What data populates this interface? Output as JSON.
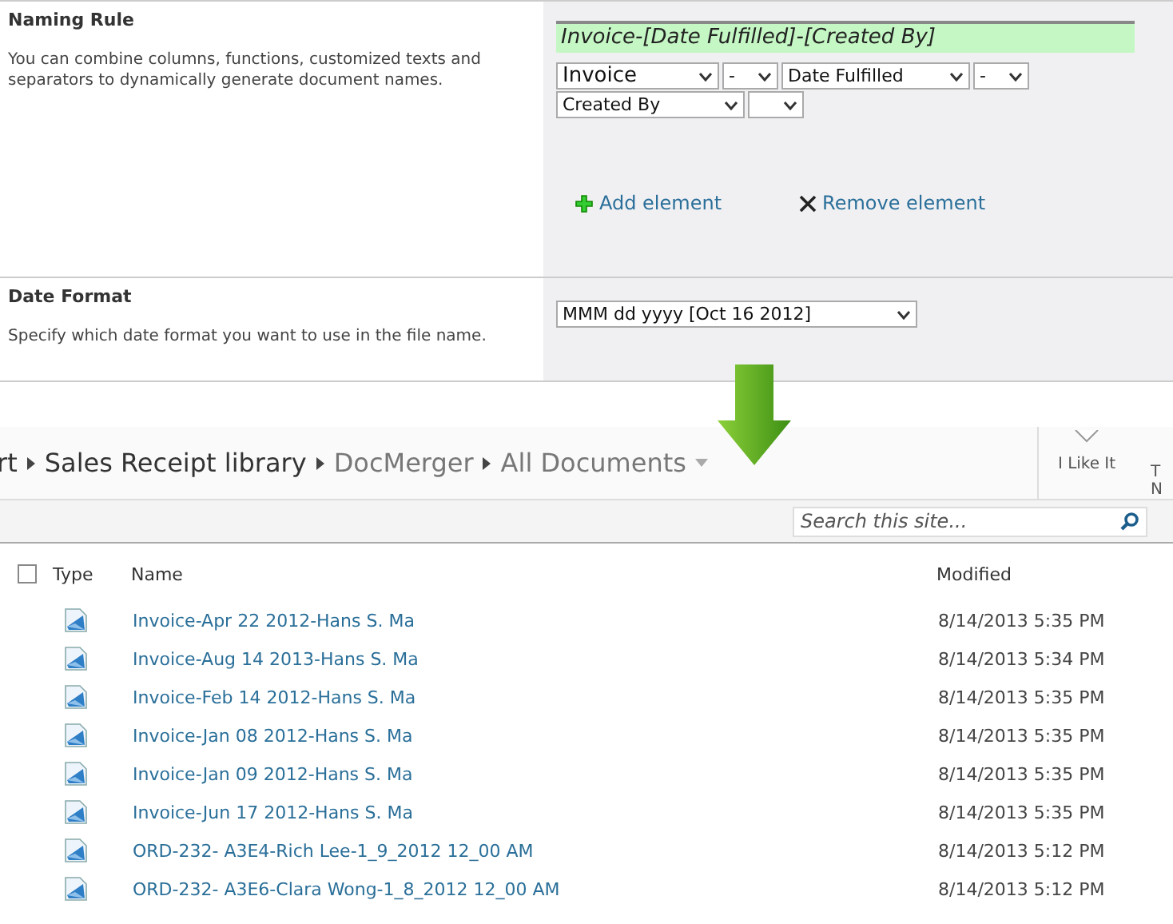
{
  "settings": [
    {
      "kind": "naming",
      "title": "Naming Rule",
      "description": "You can combine columns, functions, customized texts and separators to dynamically generate document names.",
      "preview": "Invoice-[Date Fulfilled]-[Created By]",
      "element_rows": [
        [
          {
            "value": "Invoice",
            "kind": "text"
          },
          {
            "value": "-",
            "kind": "separator"
          },
          {
            "value": "Date Fulfilled",
            "kind": "column"
          },
          {
            "value": "-",
            "kind": "separator"
          }
        ],
        [
          {
            "value": "Created By",
            "kind": "column"
          },
          {
            "kind": "separator"
          }
        ]
      ],
      "actions": [
        {
          "kind": "add",
          "label": "Add element"
        },
        {
          "kind": "remove",
          "label": "Remove element"
        }
      ]
    },
    {
      "kind": "date",
      "title": "Date Format",
      "description": "Specify which date format you want to use in the file name.",
      "value": "MMM dd yyyy [Oct 16 2012]"
    }
  ],
  "breadcrumb": [
    {
      "label": "rt",
      "current": false
    },
    {
      "label": "Sales Receipt library",
      "current": false
    },
    {
      "label": "DocMerger",
      "current": true
    },
    {
      "label": "All Documents",
      "current": true
    }
  ],
  "ribbon": [
    {
      "label": "I Like It"
    },
    {
      "label": "T\nN"
    }
  ],
  "search": {
    "placeholder": "Search this site..."
  },
  "table": {
    "select_all": {
      "checked": false
    },
    "columns": [
      "Type",
      "Name",
      "Modified"
    ],
    "rows": [
      {
        "name": "Invoice-Apr 22 2012-Hans S. Ma",
        "modified": "8/14/2013 5:35 PM"
      },
      {
        "name": "Invoice-Aug 14 2013-Hans S. Ma",
        "modified": "8/14/2013 5:34 PM"
      },
      {
        "name": "Invoice-Feb 14 2012-Hans S. Ma",
        "modified": "8/14/2013 5:35 PM"
      },
      {
        "name": "Invoice-Jan 08 2012-Hans S. Ma",
        "modified": "8/14/2013 5:35 PM"
      },
      {
        "name": "Invoice-Jan 09 2012-Hans S. Ma",
        "modified": "8/14/2013 5:35 PM"
      },
      {
        "name": "Invoice-Jun 17 2012-Hans S. Ma",
        "modified": "8/14/2013 5:35 PM"
      },
      {
        "name": "ORD-232- A3E4-Rich Lee-1_9_2012 12_00 AM",
        "modified": "8/14/2013 5:12 PM"
      },
      {
        "name": "ORD-232- A3E6-Clara Wong-1_8_2012 12_00 AM",
        "modified": "8/14/2013 5:12 PM"
      }
    ]
  }
}
